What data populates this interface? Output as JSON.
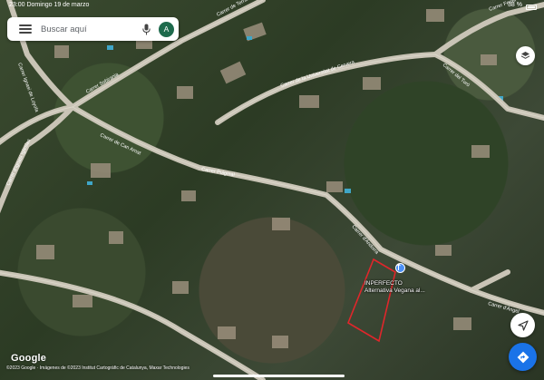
{
  "status_bar": {
    "time": "23:00",
    "date": "Domingo 19 de marzo",
    "battery": "38 %"
  },
  "search": {
    "placeholder": "Buscar aquí",
    "avatar_letter": "A"
  },
  "place": {
    "name_line1": "INPERFECTO",
    "name_line2": "Alternativa Vegana al..."
  },
  "roads": {
    "carrer_terrassa": "Carrer de Terrassa",
    "carrer_sobirania": "Carrer Sobirania",
    "carrer_ignasi_de_loyola": "Carrer Ignasi de Loyola",
    "carrer_universitat_cervera": "Carrer de la Universitat de Cervera",
    "carrer_ignasi_iglesias": "Carrer d'Ignasi Iglesias",
    "carrer_de_can_amat": "Carrer de Can Amat",
    "carrer_puigmal": "Carrer Puigmal",
    "carrer_andorra": "Carrer d'Andorra",
    "carrer_del_tura": "Carrer del Turó",
    "carrer_ferrer": "Carrer Ferrer",
    "carrer_angel": "Carrer d'Àngel"
  },
  "branding": {
    "logo": "Google",
    "attribution": "©2023 Google · Imágenes de ©2023 Institut Cartogràfic de Catalunya, Maxar Technologies"
  },
  "icons": {
    "menu": "menu-icon",
    "mic": "mic-icon",
    "layers": "layers-icon",
    "my_location": "navigation-arrow-icon",
    "directions": "directions-icon",
    "place_pin": "place-pin-icon"
  },
  "colors": {
    "accent": "#1a73e8",
    "avatar_bg": "#1e6a4c",
    "boundary": "#e0262b"
  }
}
